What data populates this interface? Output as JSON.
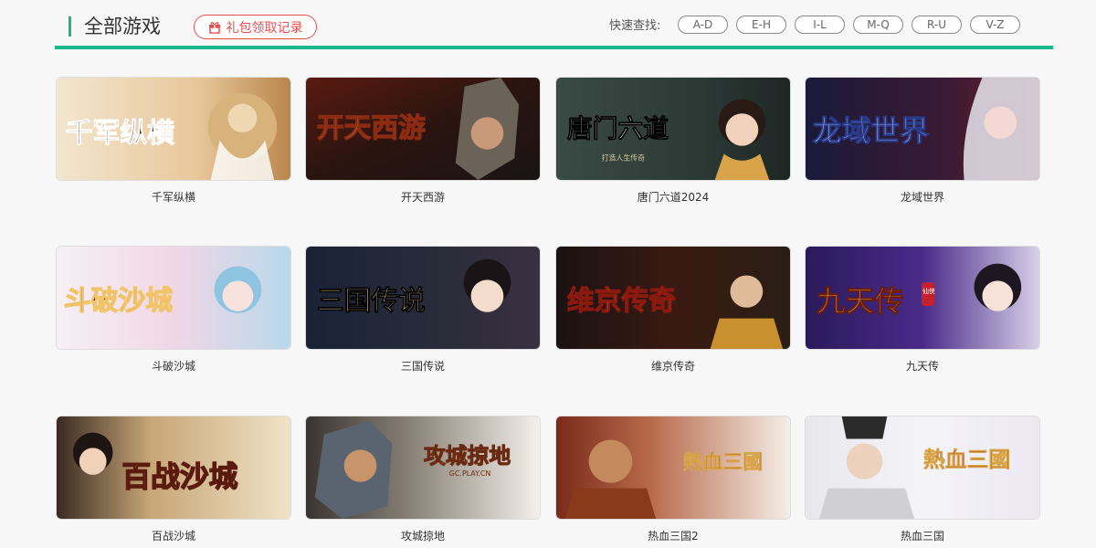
{
  "header": {
    "title": "全部游戏",
    "gift_button": "礼包领取记录",
    "quick_label": "快速查找:",
    "quick_ranges": [
      "A-D",
      "E-H",
      "I-L",
      "M-Q",
      "R-U",
      "V-Z"
    ]
  },
  "colors": {
    "accent": "#19b889",
    "gift": "#ec4c4c"
  },
  "games": [
    {
      "name": "千军纵横",
      "logo": "千军纵横"
    },
    {
      "name": "开天西游",
      "logo": "开天西游"
    },
    {
      "name": "唐门六道2024",
      "logo": "唐门六道",
      "logo_sub": "打造人生传奇"
    },
    {
      "name": "龙域世界",
      "logo": "龙域世界"
    },
    {
      "name": "斗破沙城",
      "logo": "斗破沙城"
    },
    {
      "name": "三国传说",
      "logo": "三国传说"
    },
    {
      "name": "维京传奇",
      "logo": "维京传奇"
    },
    {
      "name": "九天传",
      "logo": "九天传",
      "logo_badge": "仙侠"
    },
    {
      "name": "百战沙城",
      "logo": "百战沙城"
    },
    {
      "name": "攻城掠地",
      "logo": "攻城掠地",
      "logo_sub": "GC.PLAY.CN"
    },
    {
      "name": "热血三国2",
      "logo": "熱血三國"
    },
    {
      "name": "热血三国",
      "logo": "熱血三國"
    }
  ]
}
